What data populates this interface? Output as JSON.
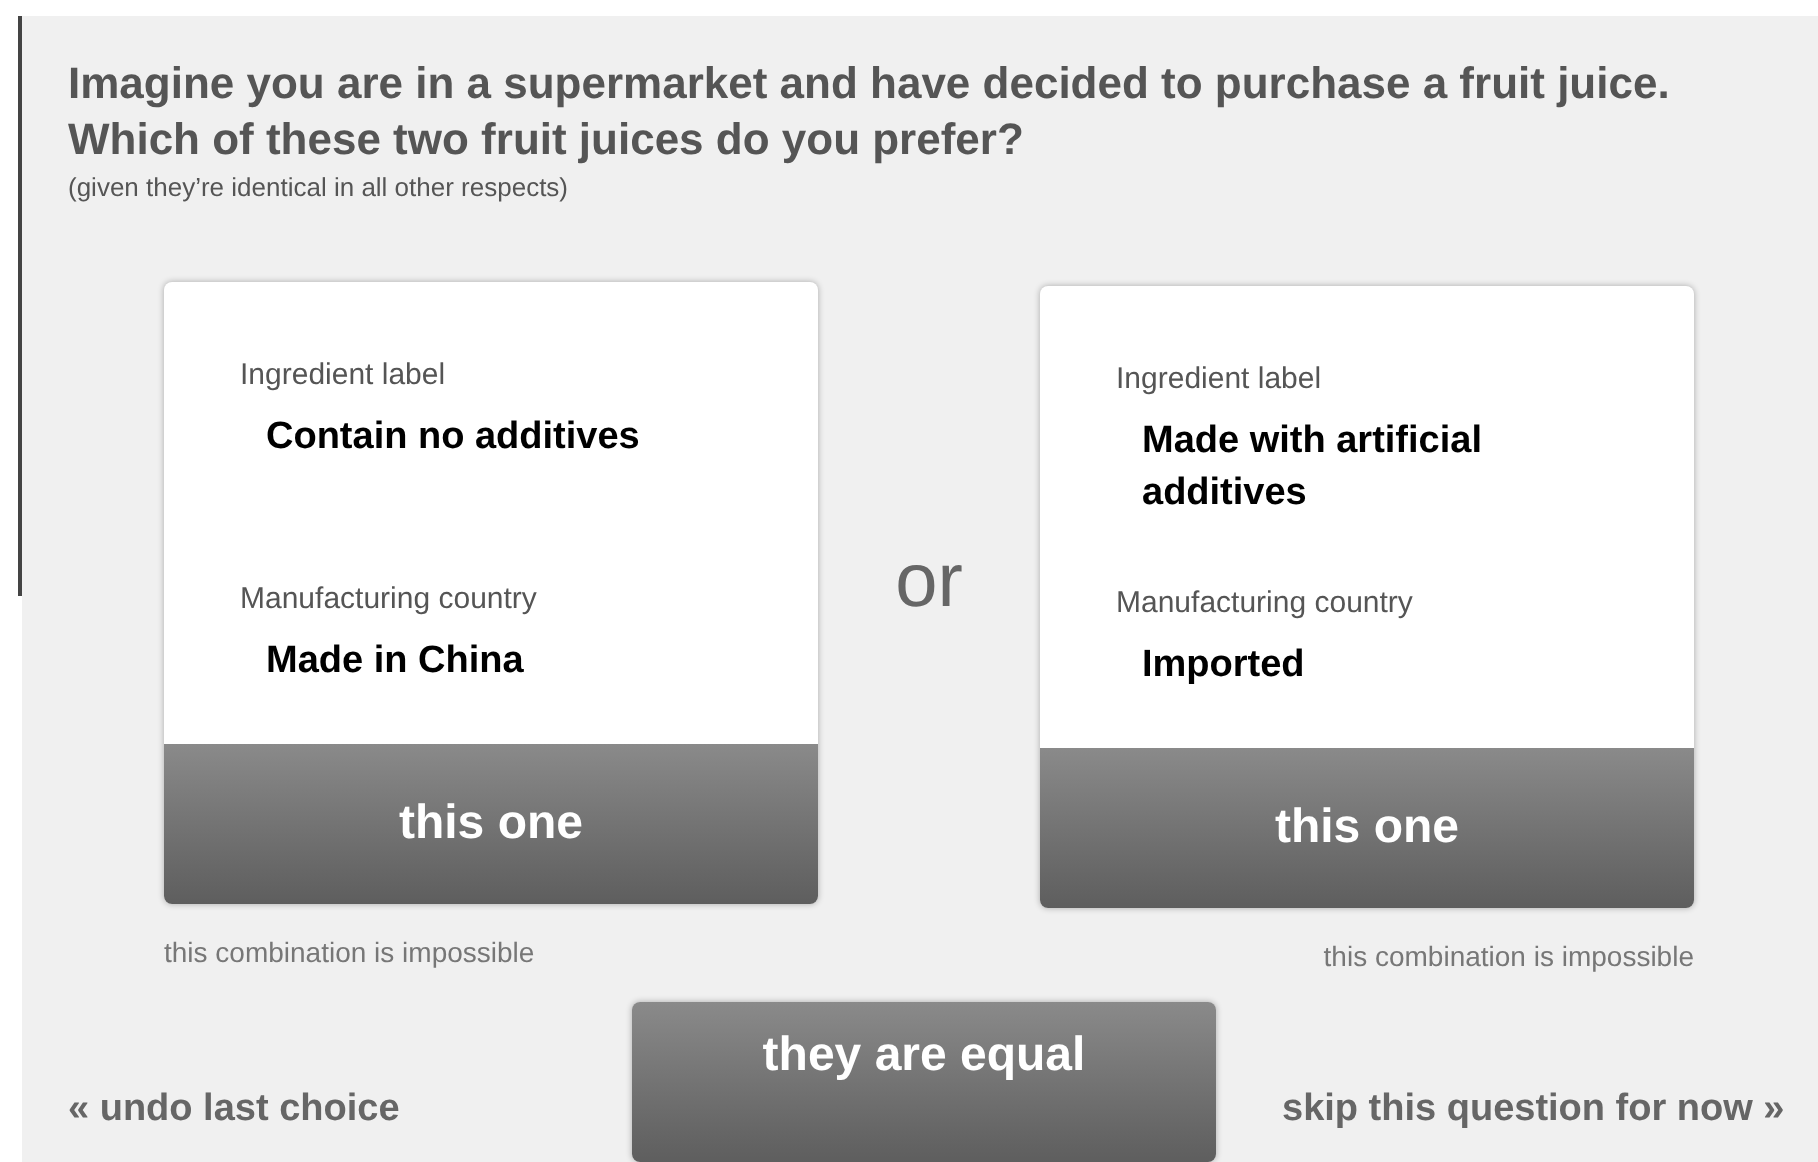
{
  "question": {
    "title": "Imagine you are in a supermarket and have decided to purchase a fruit juice.",
    "subtitle": "Which of these two fruit juices do you prefer?",
    "note": "(given they’re identical in all other respects)"
  },
  "options": [
    {
      "attributes": [
        {
          "label": "Ingredient label",
          "value": "Contain no additives"
        },
        {
          "label": "Manufacturing country",
          "value": "Made in China"
        }
      ],
      "button": "this one",
      "impossible_link": "this combination is impossible"
    },
    {
      "attributes": [
        {
          "label": "Ingredient label",
          "value": "Made with artificial additives"
        },
        {
          "label": "Manufacturing country",
          "value": "Imported"
        }
      ],
      "button": "this one",
      "impossible_link": "this combination is impossible"
    }
  ],
  "separator": "or",
  "undo": "« undo last choice",
  "equal_button": "they are equal",
  "skip": "skip this question for now »"
}
